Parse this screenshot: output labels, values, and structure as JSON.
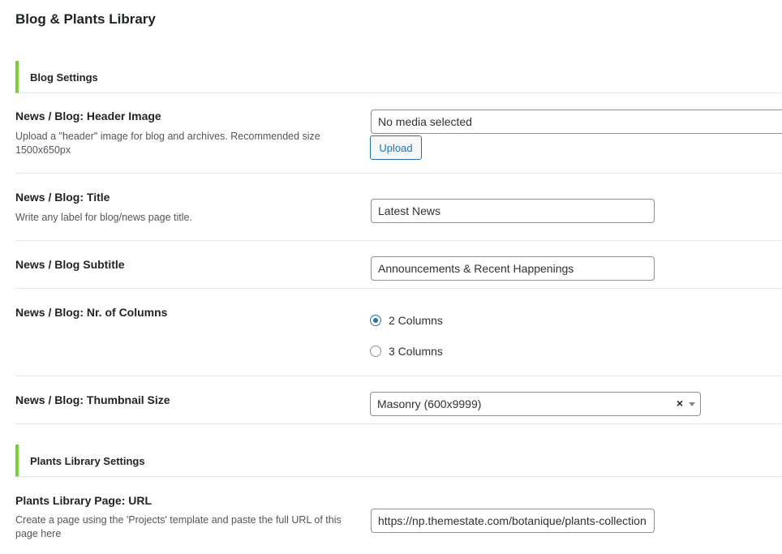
{
  "page_title": "Blog & Plants Library",
  "sections": {
    "blog": "Blog Settings",
    "plants": "Plants Library Settings"
  },
  "fields": {
    "header_image": {
      "label": "News / Blog: Header Image",
      "description": "Upload a \"header\" image for blog and archives. Recommended size 1500x650px",
      "value": "No media selected",
      "button": "Upload"
    },
    "title": {
      "label": "News / Blog: Title",
      "description": "Write any label for blog/news page title.",
      "value": "Latest News"
    },
    "subtitle": {
      "label": "News / Blog Subtitle",
      "value": "Announcements & Recent Happenings"
    },
    "columns": {
      "label": "News / Blog: Nr. of Columns",
      "options": [
        "2 Columns",
        "3 Columns"
      ],
      "selected": "2 Columns"
    },
    "thumbnail": {
      "label": "News / Blog: Thumbnail Size",
      "value": "Masonry (600x9999)",
      "clear": "×"
    },
    "plants_url": {
      "label": "Plants Library Page: URL",
      "description": "Create a page using the 'Projects' template and paste the full URL of this page here",
      "value": "https://np.themestate.com/botanique/plants-collection"
    }
  },
  "icons": {
    "select_caret": "chevron-down-icon",
    "select_clear": "close-icon"
  },
  "colors": {
    "section_accent": "#7ad03a",
    "primary": "#2271b1"
  }
}
